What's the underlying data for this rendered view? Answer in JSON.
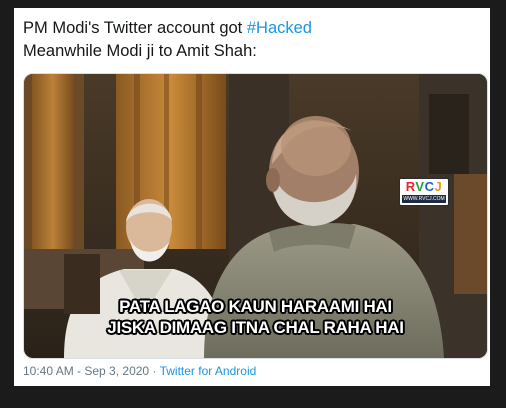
{
  "tweet": {
    "text_line1_prefix": "PM Modi's Twitter account got ",
    "hashtag": "#Hacked",
    "text_line2": "Meanwhile Modi ji to Amit Shah:",
    "time": "10:40 AM",
    "separator": "·",
    "date": "Sep 3, 2020",
    "source": "Twitter for Android"
  },
  "meme": {
    "caption_line1": "PATA LAGAO KAUN HARAAMI HAI",
    "caption_line2": "JISKA DIMAAG ITNA CHAL RAHA HAI",
    "watermark": {
      "letters": [
        "R",
        "V",
        "C",
        "J"
      ],
      "url": "WWW.RVCJ.COM"
    }
  },
  "colors": {
    "hashtag": "#1b95e0",
    "meta": "#657786",
    "text": "#14171a",
    "background": "#1b1b1b"
  }
}
